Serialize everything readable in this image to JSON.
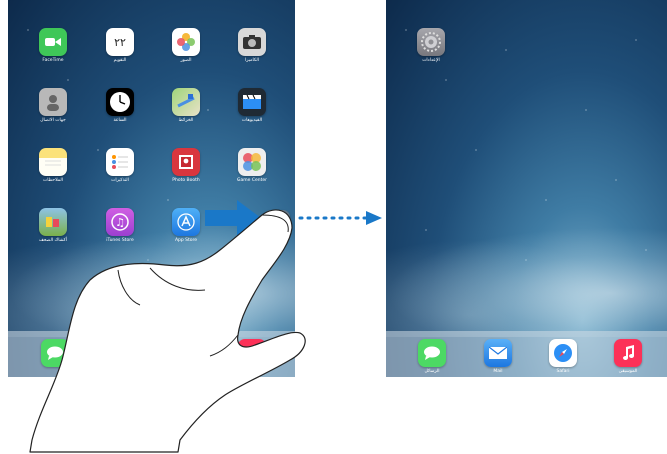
{
  "left_screen": {
    "apps": [
      {
        "label": "FaceTime",
        "icon": "facetime-icon",
        "color": "#3fc758"
      },
      {
        "label": "التقويم",
        "icon": "calendar-icon",
        "color": "#ffffff",
        "glyph": "٢٢"
      },
      {
        "label": "الصور",
        "icon": "photos-icon",
        "color": "#ffffff"
      },
      {
        "label": "الكاميرا",
        "icon": "camera-icon",
        "color": "#d8d8d8"
      },
      {
        "label": "جهات الاتصال",
        "icon": "contacts-icon",
        "color": "#b8b8b8"
      },
      {
        "label": "الساعة",
        "icon": "clock-icon",
        "color": "#000000"
      },
      {
        "label": "الخرائط",
        "icon": "maps-icon",
        "color": "#7fc36f"
      },
      {
        "label": "الفيديوهات",
        "icon": "videos-icon",
        "color": "#1f2a34"
      },
      {
        "label": "الملاحظات",
        "icon": "notes-icon",
        "color": "#fbe27a"
      },
      {
        "label": "التذكيرات",
        "icon": "reminders-icon",
        "color": "#ffffff"
      },
      {
        "label": "Photo Booth",
        "icon": "photo-booth-icon",
        "color": "#d9363e"
      },
      {
        "label": "Game Center",
        "icon": "game-center-icon",
        "color": "#eeeeee"
      },
      {
        "label": "أكشاك الصحف",
        "icon": "newsstand-icon",
        "color": "#7ab04b"
      },
      {
        "label": "iTunes Store",
        "icon": "itunes-store-icon",
        "color": "#b64cd6"
      },
      {
        "label": "App Store",
        "icon": "app-store-icon",
        "color": "#2a8ff0"
      }
    ]
  },
  "right_screen": {
    "apps": [
      {
        "label": "الإعدادات",
        "icon": "settings-icon",
        "color": "#8e8e93"
      }
    ],
    "dock": [
      {
        "label": "الرسائل",
        "icon": "messages-icon",
        "color": "#4cd964"
      },
      {
        "label": "Mail",
        "icon": "mail-icon",
        "color": "#2c8ff5"
      },
      {
        "label": "Safari",
        "icon": "safari-icon",
        "color": "#ffffff"
      },
      {
        "label": "الموسيقى",
        "icon": "music-icon",
        "color": "#fc3158"
      }
    ]
  },
  "colors": {
    "arrow": "#1a78c8"
  }
}
